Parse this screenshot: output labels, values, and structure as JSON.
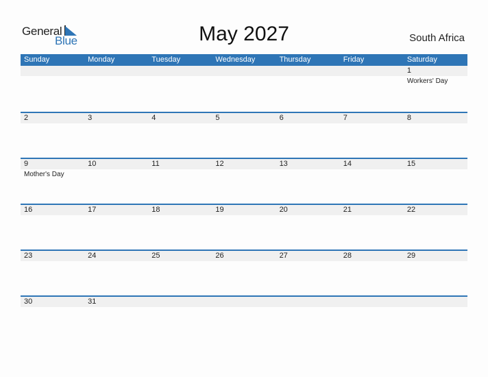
{
  "logo": {
    "word1": "General",
    "word2": "Blue",
    "icon": "triangle-flag-icon"
  },
  "title": "May 2027",
  "country": "South Africa",
  "colors": {
    "accent": "#2e75b6",
    "strip": "#f0f0f0"
  },
  "weekdays": [
    "Sunday",
    "Monday",
    "Tuesday",
    "Wednesday",
    "Thursday",
    "Friday",
    "Saturday"
  ],
  "weeks": [
    [
      {
        "d": "",
        "e": ""
      },
      {
        "d": "",
        "e": ""
      },
      {
        "d": "",
        "e": ""
      },
      {
        "d": "",
        "e": ""
      },
      {
        "d": "",
        "e": ""
      },
      {
        "d": "",
        "e": ""
      },
      {
        "d": "1",
        "e": "Workers' Day"
      }
    ],
    [
      {
        "d": "2",
        "e": ""
      },
      {
        "d": "3",
        "e": ""
      },
      {
        "d": "4",
        "e": ""
      },
      {
        "d": "5",
        "e": ""
      },
      {
        "d": "6",
        "e": ""
      },
      {
        "d": "7",
        "e": ""
      },
      {
        "d": "8",
        "e": ""
      }
    ],
    [
      {
        "d": "9",
        "e": "Mother's Day"
      },
      {
        "d": "10",
        "e": ""
      },
      {
        "d": "11",
        "e": ""
      },
      {
        "d": "12",
        "e": ""
      },
      {
        "d": "13",
        "e": ""
      },
      {
        "d": "14",
        "e": ""
      },
      {
        "d": "15",
        "e": ""
      }
    ],
    [
      {
        "d": "16",
        "e": ""
      },
      {
        "d": "17",
        "e": ""
      },
      {
        "d": "18",
        "e": ""
      },
      {
        "d": "19",
        "e": ""
      },
      {
        "d": "20",
        "e": ""
      },
      {
        "d": "21",
        "e": ""
      },
      {
        "d": "22",
        "e": ""
      }
    ],
    [
      {
        "d": "23",
        "e": ""
      },
      {
        "d": "24",
        "e": ""
      },
      {
        "d": "25",
        "e": ""
      },
      {
        "d": "26",
        "e": ""
      },
      {
        "d": "27",
        "e": ""
      },
      {
        "d": "28",
        "e": ""
      },
      {
        "d": "29",
        "e": ""
      }
    ],
    [
      {
        "d": "30",
        "e": ""
      },
      {
        "d": "31",
        "e": ""
      },
      {
        "d": "",
        "e": ""
      },
      {
        "d": "",
        "e": ""
      },
      {
        "d": "",
        "e": ""
      },
      {
        "d": "",
        "e": ""
      },
      {
        "d": "",
        "e": ""
      }
    ]
  ]
}
